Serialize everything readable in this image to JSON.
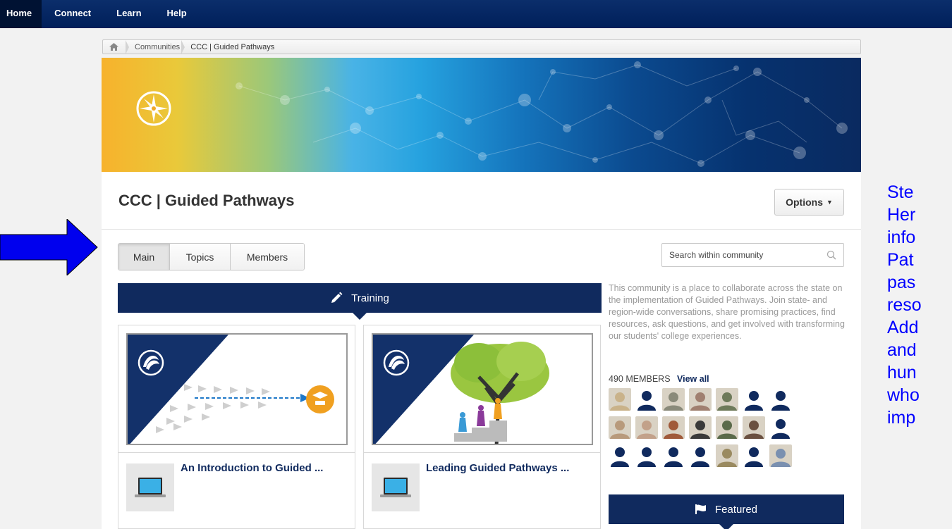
{
  "nav": {
    "items": [
      {
        "label": "Home"
      },
      {
        "label": "Connect"
      },
      {
        "label": "Learn"
      },
      {
        "label": "Help"
      }
    ]
  },
  "breadcrumb": {
    "items": [
      "Communities",
      "CCC | Guided Pathways"
    ]
  },
  "community": {
    "title": "CCC | Guided Pathways",
    "options_label": "Options",
    "tabs": [
      "Main",
      "Topics",
      "Members"
    ],
    "search_placeholder": "Search within community",
    "description": "This community is a place to collaborate across the state on the implementation of Guided Pathways. Join state- and region-wide conversations, share promising practices, find resources, ask questions, and get involved with transforming our students' college experiences.",
    "members_count": "490 MEMBERS",
    "view_all": "View all"
  },
  "training": {
    "label": "Training",
    "cards": [
      {
        "title": "An Introduction to Guided ..."
      },
      {
        "title": "Leading Guided Pathways ..."
      }
    ]
  },
  "featured": {
    "label": "Featured"
  },
  "side_note": {
    "lines": [
      "Ste",
      "Her",
      "info",
      "Pat",
      "pas",
      "reso",
      "Add",
      "and",
      "hun",
      "who",
      "imp"
    ]
  },
  "colors": {
    "nav_bg": "#001f5a",
    "section_bar": "#102a5e",
    "annotation": "#0000ff",
    "arrow": "#0000ee"
  },
  "members": [
    {
      "kind": "photo",
      "color": "#c9b28a"
    },
    {
      "kind": "generic"
    },
    {
      "kind": "photo",
      "color": "#8a8a7a"
    },
    {
      "kind": "photo",
      "color": "#a08070"
    },
    {
      "kind": "photo",
      "color": "#6e7a5a"
    },
    {
      "kind": "generic"
    },
    {
      "kind": "generic"
    },
    {
      "kind": "photo",
      "color": "#b89a7c"
    },
    {
      "kind": "photo",
      "color": "#c2a18a"
    },
    {
      "kind": "photo",
      "color": "#a05a3a"
    },
    {
      "kind": "photo",
      "color": "#3a3a3a"
    },
    {
      "kind": "photo",
      "color": "#5a6a4a"
    },
    {
      "kind": "photo",
      "color": "#6a5040"
    },
    {
      "kind": "generic"
    },
    {
      "kind": "generic"
    },
    {
      "kind": "generic"
    },
    {
      "kind": "generic"
    },
    {
      "kind": "generic"
    },
    {
      "kind": "photo",
      "color": "#9a8a60"
    },
    {
      "kind": "generic"
    },
    {
      "kind": "photo",
      "color": "#7a90b0"
    }
  ]
}
